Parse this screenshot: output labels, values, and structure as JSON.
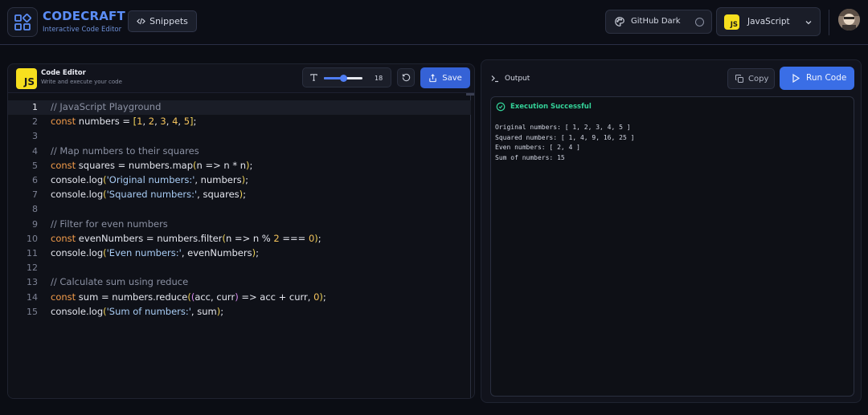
{
  "header": {
    "brand_title": "CODECRAFT",
    "brand_subtitle": "Interactive Code Editor",
    "snippets_label": "Snippets",
    "theme_label": "GitHub Dark",
    "language_label": "JavaScript",
    "language_badge": "JS"
  },
  "editor": {
    "badge": "JS",
    "title": "Code Editor",
    "subtitle": "Write and execute your code",
    "font_size": "18",
    "font_slider_fraction": 0.52,
    "save_label": "Save",
    "active_line": 1,
    "lines": [
      {
        "n": "1",
        "parts": [
          [
            "c",
            "// JavaScript Playground"
          ]
        ]
      },
      {
        "n": "2",
        "parts": [
          [
            "k",
            "const"
          ],
          [
            "t",
            " numbers = "
          ],
          [
            "b",
            "["
          ],
          [
            "n",
            "1"
          ],
          [
            "t",
            ", "
          ],
          [
            "n",
            "2"
          ],
          [
            "t",
            ", "
          ],
          [
            "n",
            "3"
          ],
          [
            "t",
            ", "
          ],
          [
            "n",
            "4"
          ],
          [
            "t",
            ", "
          ],
          [
            "n",
            "5"
          ],
          [
            "b",
            "]"
          ],
          [
            "t",
            ";"
          ]
        ]
      },
      {
        "n": "3",
        "parts": []
      },
      {
        "n": "4",
        "parts": [
          [
            "c",
            "// Map numbers to their squares"
          ]
        ]
      },
      {
        "n": "5",
        "parts": [
          [
            "k",
            "const"
          ],
          [
            "t",
            " squares = numbers.map"
          ],
          [
            "b",
            "("
          ],
          [
            "t",
            "n => n * n"
          ],
          [
            "b",
            ")"
          ],
          [
            "t",
            ";"
          ]
        ]
      },
      {
        "n": "6",
        "parts": [
          [
            "t",
            "console.log"
          ],
          [
            "b",
            "("
          ],
          [
            "s",
            "'Original numbers:'"
          ],
          [
            "t",
            ", numbers"
          ],
          [
            "b",
            ")"
          ],
          [
            "t",
            ";"
          ]
        ]
      },
      {
        "n": "7",
        "parts": [
          [
            "t",
            "console.log"
          ],
          [
            "b",
            "("
          ],
          [
            "s",
            "'Squared numbers:'"
          ],
          [
            "t",
            ", squares"
          ],
          [
            "b",
            ")"
          ],
          [
            "t",
            ";"
          ]
        ]
      },
      {
        "n": "8",
        "parts": []
      },
      {
        "n": "9",
        "parts": [
          [
            "c",
            "// Filter for even numbers"
          ]
        ]
      },
      {
        "n": "10",
        "parts": [
          [
            "k",
            "const"
          ],
          [
            "t",
            " evenNumbers = numbers.filter"
          ],
          [
            "b",
            "("
          ],
          [
            "t",
            "n => n % "
          ],
          [
            "n",
            "2"
          ],
          [
            "t",
            " === "
          ],
          [
            "n",
            "0"
          ],
          [
            "b",
            ")"
          ],
          [
            "t",
            ";"
          ]
        ]
      },
      {
        "n": "11",
        "parts": [
          [
            "t",
            "console.log"
          ],
          [
            "b",
            "("
          ],
          [
            "s",
            "'Even numbers:'"
          ],
          [
            "t",
            ", evenNumbers"
          ],
          [
            "b",
            ")"
          ],
          [
            "t",
            ";"
          ]
        ]
      },
      {
        "n": "12",
        "parts": []
      },
      {
        "n": "13",
        "parts": [
          [
            "c",
            "// Calculate sum using reduce"
          ]
        ]
      },
      {
        "n": "14",
        "parts": [
          [
            "k",
            "const"
          ],
          [
            "t",
            " sum = numbers.reduce"
          ],
          [
            "b",
            "("
          ],
          [
            "p",
            "("
          ],
          [
            "t",
            "acc, curr"
          ],
          [
            "p",
            ")"
          ],
          [
            "t",
            " => acc + curr, "
          ],
          [
            "n",
            "0"
          ],
          [
            "b",
            ")"
          ],
          [
            "t",
            ";"
          ]
        ]
      },
      {
        "n": "15",
        "parts": [
          [
            "t",
            "console.log"
          ],
          [
            "b",
            "("
          ],
          [
            "s",
            "'Sum of numbers:'"
          ],
          [
            "t",
            ", sum"
          ],
          [
            "b",
            ")"
          ],
          [
            "t",
            ";"
          ]
        ]
      }
    ]
  },
  "output": {
    "title": "Output",
    "copy_label": "Copy",
    "run_label": "Run Code",
    "status": "Execution Successful",
    "lines": [
      "Original numbers: [ 1, 2, 3, 4, 5 ]",
      "Squared numbers: [ 1, 4, 9, 16, 25 ]",
      "Even numbers: [ 2, 4 ]",
      "Sum of numbers: 15"
    ]
  },
  "colors": {
    "accent": "#3a6ee6",
    "brand": "#5b8df6",
    "success": "#34d399",
    "js_yellow": "#f7df1e"
  },
  "icons": {
    "logo": "blocks-icon",
    "snippets": "code-icon",
    "theme": "palette-icon",
    "chevron": "chevron-down-icon",
    "font": "type-icon",
    "reset": "rotate-ccw-icon",
    "save": "share-icon",
    "terminal": "terminal-icon",
    "copy": "copy-icon",
    "run": "play-icon",
    "success": "check-circle-icon"
  }
}
